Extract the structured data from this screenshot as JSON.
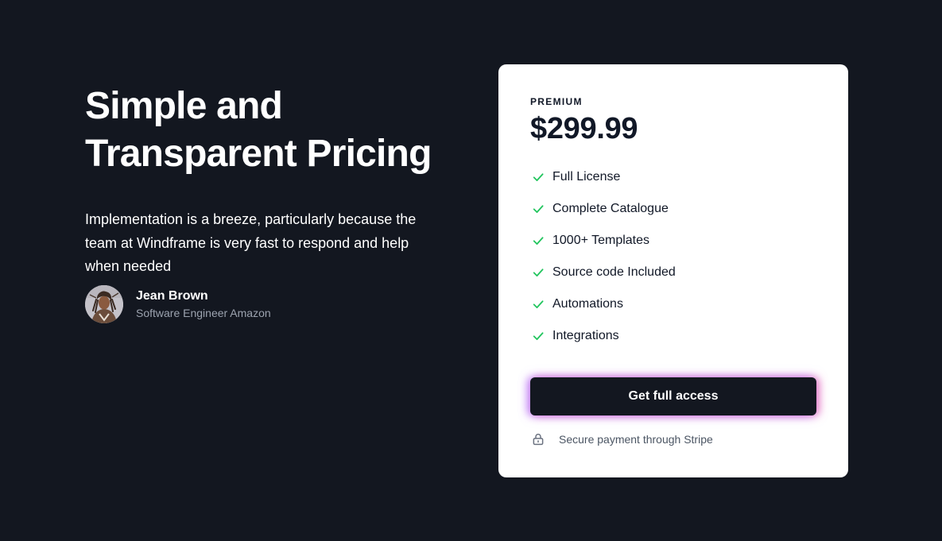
{
  "hero": {
    "title_line1": "Simple and",
    "title_line2": "Transparent Pricing",
    "quote": "Implementation is a breeze, particularly because the team at Windframe is very fast to respond and help when needed"
  },
  "author": {
    "name": "Jean Brown",
    "role": "Software Engineer Amazon"
  },
  "card": {
    "plan": "PREMIUM",
    "price": "$299.99",
    "features": [
      {
        "label": "Full License"
      },
      {
        "label": "Complete Catalogue"
      },
      {
        "label": "1000+ Templates"
      },
      {
        "label": "Source code Included"
      },
      {
        "label": "Automations"
      },
      {
        "label": "Integrations"
      }
    ],
    "cta_label": "Get full access",
    "secure_text": "Secure payment through Stripe"
  },
  "colors": {
    "background": "#131720",
    "card": "#ffffff",
    "check": "#22c55e",
    "cta_glow_left": "#a855f7",
    "cta_glow_right": "#ec4899"
  },
  "icons": {
    "feature": "check-icon",
    "secure": "lock-icon"
  }
}
